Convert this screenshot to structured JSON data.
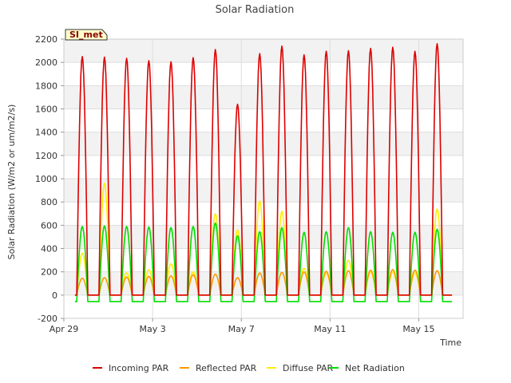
{
  "chart_data": {
    "type": "line",
    "title": "Solar Radiation",
    "xlabel": "Time",
    "ylabel": "Solar Radiation (W/m2 or um/m2/s)",
    "site_label": "SI_met",
    "x_range_days": [
      0,
      18
    ],
    "x_ticks": [
      {
        "label": "Apr 29",
        "day": 0
      },
      {
        "label": "May 3",
        "day": 4
      },
      {
        "label": "May 7",
        "day": 8
      },
      {
        "label": "May 11",
        "day": 12
      },
      {
        "label": "May 15",
        "day": 16
      }
    ],
    "ylim": [
      -200,
      2200
    ],
    "y_ticks": [
      -200,
      0,
      200,
      400,
      600,
      800,
      1000,
      1200,
      1400,
      1600,
      1800,
      2000,
      2200
    ],
    "grid": true,
    "legend_position": "bottom",
    "daily_peaks": {
      "incoming_par": [
        2050,
        2045,
        2035,
        2015,
        2005,
        2040,
        2110,
        1640,
        2075,
        2140,
        2065,
        2095,
        2100,
        2120,
        2130,
        2095,
        2160
      ],
      "reflected_par": [
        145,
        150,
        155,
        160,
        165,
        175,
        180,
        150,
        190,
        195,
        200,
        205,
        210,
        215,
        220,
        215,
        210
      ],
      "diffuse_par": [
        360,
        960,
        190,
        220,
        270,
        200,
        700,
        560,
        810,
        720,
        230,
        190,
        300,
        200,
        200,
        190,
        740
      ],
      "net_radiation": [
        590,
        595,
        590,
        585,
        580,
        590,
        620,
        510,
        545,
        580,
        540,
        545,
        580,
        545,
        540,
        540,
        565
      ]
    },
    "night_values": {
      "incoming_par": 0,
      "reflected_par": 0,
      "diffuse_par": 0,
      "net_radiation": -55
    },
    "series": [
      {
        "name": "Incoming PAR",
        "key": "incoming_par",
        "color": "#dd0000"
      },
      {
        "name": "Reflected PAR",
        "key": "reflected_par",
        "color": "#ff9900"
      },
      {
        "name": "Diffuse PAR",
        "key": "diffuse_par",
        "color": "#ffee00"
      },
      {
        "name": "Net Radiation",
        "key": "net_radiation",
        "color": "#00dd00"
      }
    ]
  }
}
